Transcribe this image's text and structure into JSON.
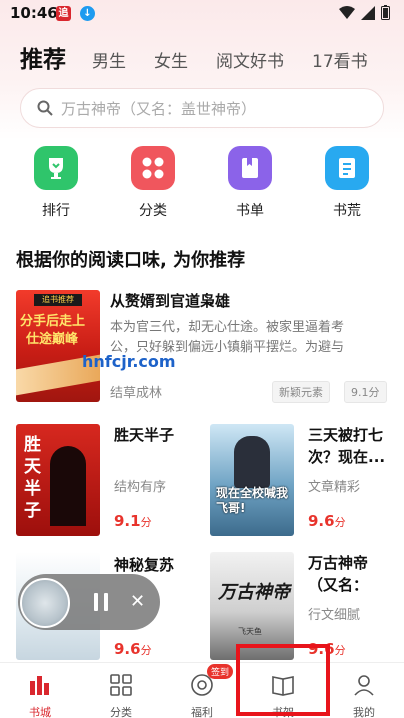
{
  "status": {
    "time": "10:46",
    "badge1": "追",
    "badge2": "↓"
  },
  "tabs": [
    "推荐",
    "男生",
    "女生",
    "阅文好书",
    "17看书"
  ],
  "search": {
    "placeholder": "万古神帝（又名：盖世神帝）"
  },
  "quick_entries": [
    {
      "label": "排行",
      "icon": "trophy-icon",
      "color": "#2fc56b"
    },
    {
      "label": "分类",
      "icon": "grid-icon",
      "color": "#f0565d"
    },
    {
      "label": "书单",
      "icon": "booklist-icon",
      "color": "#8b63e9"
    },
    {
      "label": "书荒",
      "icon": "book-icon",
      "color": "#28a9f0"
    }
  ],
  "section_title": "根据你的阅读口味, 为你推荐",
  "featured": {
    "title": "从赘婿到官道枭雄",
    "desc1": "本为官三代，却无心仕途。被家里逼着考",
    "desc2": "公，只好躲到偏远小镇躺平摆烂。为避与",
    "desc3": "",
    "author": "结草成林",
    "tag": "新颖元素",
    "score": "9.1",
    "score_unit": "分",
    "cover_line1": "分手后走上",
    "cover_line2": "仕途巅峰",
    "cover_badge": "追书推荐"
  },
  "watermark": "hnfcjr.com",
  "books": [
    {
      "title": "胜天半子",
      "tag": "结构有序",
      "score": "9.1",
      "unit": "分",
      "cover": "胜天半子"
    },
    {
      "title1": "三天被打七",
      "title2": "次？现在...",
      "tag": "文章精彩",
      "score": "9.6",
      "unit": "分",
      "cover": "现在全校喊我飞哥!"
    },
    {
      "title": "神秘复苏",
      "score": "9.6",
      "unit": "分"
    },
    {
      "title1": "万古神帝",
      "title2": "（又名：",
      "tag": "行文细腻",
      "score": "9.6",
      "unit": "分",
      "cover": "万古神帝",
      "cover_author": "飞天鱼"
    }
  ],
  "nav": [
    {
      "label": "书城",
      "icon": "bookstore-icon",
      "active": true
    },
    {
      "label": "分类",
      "icon": "category-icon"
    },
    {
      "label": "福利",
      "icon": "welfare-icon",
      "badge": "签到"
    },
    {
      "label": "书架",
      "icon": "bookshelf-icon"
    },
    {
      "label": "我的",
      "icon": "profile-icon"
    }
  ],
  "colors": {
    "accent": "#d9272e",
    "score": "#e8332c",
    "highlight": "#e8141b"
  }
}
